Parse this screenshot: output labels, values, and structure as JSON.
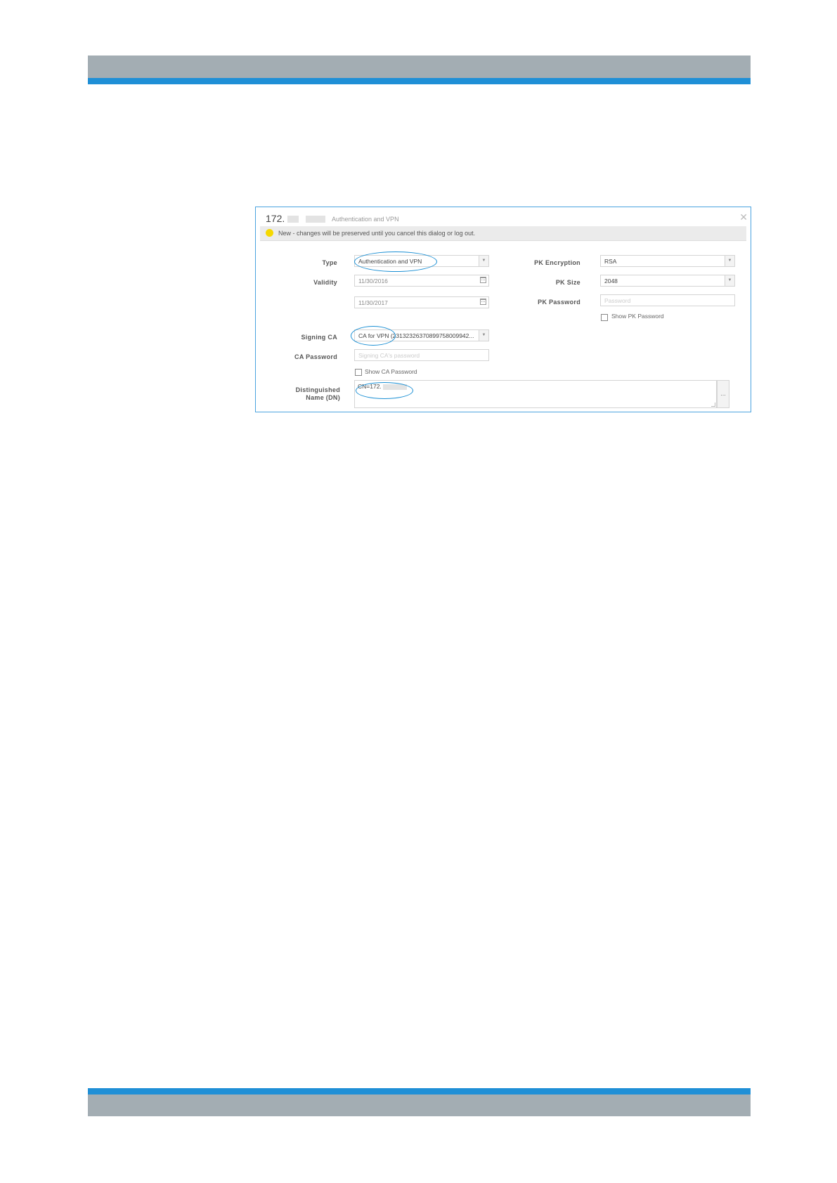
{
  "dialog": {
    "title_prefix": "172.",
    "subtitle": "Authentication and VPN",
    "notice": "New - changes will be preserved until you cancel this dialog or log out."
  },
  "form": {
    "type": {
      "label": "Type",
      "value": "Authentication and VPN"
    },
    "validity": {
      "label": "Validity",
      "start": "11/30/2016",
      "end": "11/30/2017"
    },
    "signing_ca": {
      "label": "Signing CA",
      "value": "CA for VPN (23132326370899758009942..."
    },
    "ca_password": {
      "label": "CA Password",
      "placeholder": "Signing CA's password",
      "show_label": "Show CA Password",
      "show_checked": false
    },
    "dn": {
      "label_line1": "Distinguished",
      "label_line2": "Name (DN)",
      "value": "CN=172.",
      "button": "..."
    },
    "pk_encryption": {
      "label": "PK Encryption",
      "value": "RSA"
    },
    "pk_size": {
      "label": "PK Size",
      "value": "2048"
    },
    "pk_password": {
      "label": "PK Password",
      "placeholder": "Password",
      "show_label": "Show PK Password",
      "show_checked": false
    }
  },
  "icons": {
    "close": "close-icon",
    "notice": "warning-icon",
    "calendar": "calendar-icon",
    "dropdown": "chevron-down-icon"
  },
  "colors": {
    "brand_blue": "#1f8fd6",
    "header_gray": "#a3adb3",
    "highlight_ellipse": "#1a8fd4",
    "notice_icon": "#f5d800"
  }
}
